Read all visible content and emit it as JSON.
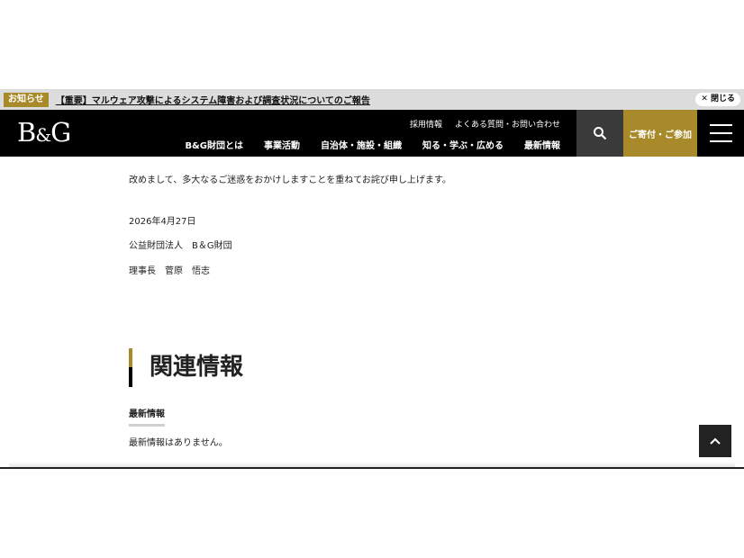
{
  "notice": {
    "badge": "お知らせ",
    "link": "【重要】マルウェア攻撃によるシステム障害および調査状況についてのご報告",
    "close": "✕ 閉じる"
  },
  "header": {
    "logo_left": "B",
    "logo_amp": "&",
    "logo_right": "G",
    "sub_nav": [
      "採用情報",
      "よくある質問・お問い合わせ"
    ],
    "main_nav": [
      "B&G財団とは",
      "事業活動",
      "自治体・施設・組織",
      "知る・学ぶ・広める",
      "最新情報"
    ],
    "donate": "ご寄付・ご参加"
  },
  "article": {
    "apology": "改めまして、多大なるご迷惑をおかけしますことを重ねてお詫び申し上げます。",
    "date": "2026年4月27日",
    "organization": "公益財団法人　B＆G財団",
    "signatory": "理事長　菅原　悟志"
  },
  "related": {
    "heading": "関連情報",
    "tab": "最新情報",
    "empty": "最新情報はありません。"
  },
  "colors": {
    "accent_gold": "#a88a2a",
    "header_bg": "#000000",
    "search_bg": "#3a3a3a"
  },
  "icons": {
    "search": "search-icon",
    "menu": "hamburger-icon",
    "to_top": "chevron-up-icon"
  }
}
